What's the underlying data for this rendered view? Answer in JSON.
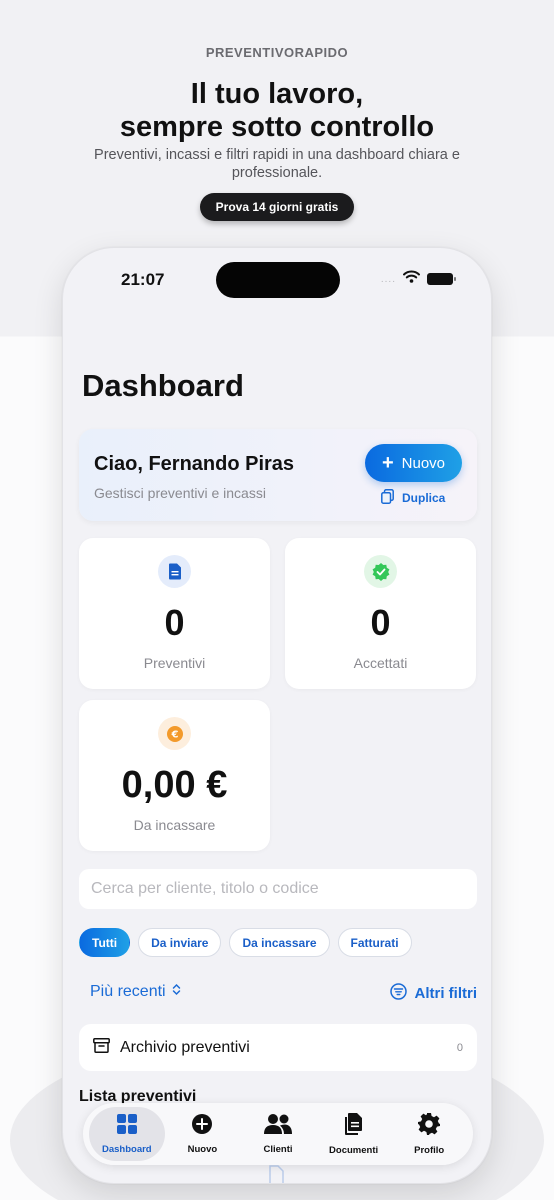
{
  "promo": {
    "brand": "PREVENTIVORAPIDO",
    "headline_line1": "Il tuo lavoro,",
    "headline_line2": "sempre sotto controllo",
    "subtitle": "Preventivi, incassi e filtri rapidi in una dashboard chiara e professionale.",
    "trial_button": "Prova 14 giorni gratis"
  },
  "status_bar": {
    "time": "21:07",
    "signal": "....",
    "icons": [
      "wifi-icon",
      "battery-icon"
    ]
  },
  "dashboard": {
    "title": "Dashboard",
    "greeting": {
      "name": "Ciao, Fernando Piras",
      "subtitle": "Gestisci preventivi e incassi",
      "new_button": "Nuovo",
      "duplicate_link": "Duplica"
    },
    "stats": [
      {
        "value": "0",
        "label": "Preventivi",
        "icon": "document-icon",
        "color": "#1a5fc8"
      },
      {
        "value": "0",
        "label": "Accettati",
        "icon": "check-badge-icon",
        "color": "#34c759"
      },
      {
        "value": "0,00 €",
        "label": "Da incassare",
        "icon": "euro-coin-icon",
        "color": "#f39a2b"
      }
    ],
    "search_placeholder": "Cerca per cliente, titolo o codice",
    "chips": [
      "Tutti",
      "Da inviare",
      "Da incassare",
      "Fatturati"
    ],
    "active_chip": "Tutti",
    "sort_label": "Più recenti",
    "filters_label": "Altri filtri",
    "archive": {
      "label": "Archivio preventivi",
      "count": "0"
    },
    "list_title": "Lista preventivi"
  },
  "tabbar": {
    "tabs": [
      {
        "label": "Dashboard",
        "icon": "grid-icon",
        "active": true
      },
      {
        "label": "Nuovo",
        "icon": "plus-circle-icon",
        "active": false
      },
      {
        "label": "Clienti",
        "icon": "people-icon",
        "active": false
      },
      {
        "label": "Documenti",
        "icon": "documents-icon",
        "active": false
      },
      {
        "label": "Profilo",
        "icon": "gear-icon",
        "active": false
      }
    ]
  },
  "colors": {
    "accent": "#1a6bd6",
    "accent_gradient_start": "#0a6ae0",
    "accent_gradient_end": "#1fa0e6",
    "background": "#f2f2f6"
  }
}
